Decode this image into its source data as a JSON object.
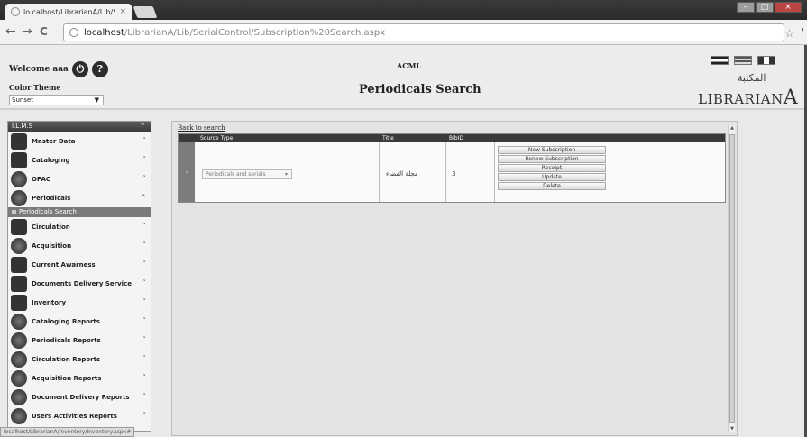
{
  "browser": {
    "tab_title": "lo calhost/LibrarianA/Lib/S",
    "tab_close": "×",
    "url_host": "localhost",
    "url_path": "/LibrarianA/Lib/SerialControl/Subscription%20Search.aspx",
    "back": "←",
    "forward": "→",
    "reload": "C",
    "star": "☆",
    "wrench": "'",
    "status_url": "localhost/LibrarianA/Inventory/Inventory.aspx#"
  },
  "header": {
    "welcome": "Welcome aaa",
    "color_theme_label": "Color Theme",
    "color_theme_value": "Sunset",
    "org": "ACML",
    "page_title": "Periodicals Search",
    "logo_arabic": "المكتبة",
    "logo_text": "LIBRARIAN",
    "logo_letter": "A"
  },
  "sidebar": {
    "heading": "I.L.M.S",
    "items": [
      {
        "label": "Master Data",
        "icon": "monitor-icon"
      },
      {
        "label": "Cataloging",
        "icon": "books-icon"
      },
      {
        "label": "OPAC",
        "icon": "opac-icon"
      },
      {
        "label": "Periodicals",
        "icon": "periodicals-icon"
      },
      {
        "label": "Circulation",
        "icon": "circulation-icon"
      },
      {
        "label": "Acquisition",
        "icon": "acquisition-icon"
      },
      {
        "label": "Current Awarness",
        "icon": "awareness-icon"
      },
      {
        "label": "Documents Delivery Service",
        "icon": "delivery-icon"
      },
      {
        "label": "Inventory",
        "icon": "inventory-icon"
      },
      {
        "label": "Cataloging Reports",
        "icon": "report-icon"
      },
      {
        "label": "Periodicals Reports",
        "icon": "report-icon"
      },
      {
        "label": "Circulation Reports",
        "icon": "report-icon"
      },
      {
        "label": "Acquisition Reports",
        "icon": "report-icon"
      },
      {
        "label": "Document Delivery Reports",
        "icon": "report-icon"
      },
      {
        "label": "Users Activities Reports",
        "icon": "report-icon"
      }
    ],
    "sub_item": "Periodicals Search"
  },
  "main": {
    "back_link": "Back to search",
    "columns": [
      "Source Type",
      "Title",
      "BibID"
    ],
    "row": {
      "source_type": "Periodicals and serials",
      "title": "مجلة الفضاء",
      "bibid": "3"
    },
    "actions": [
      "New Subscription",
      "Renew Subscription",
      "Receipt",
      "Update",
      "Delete"
    ]
  }
}
